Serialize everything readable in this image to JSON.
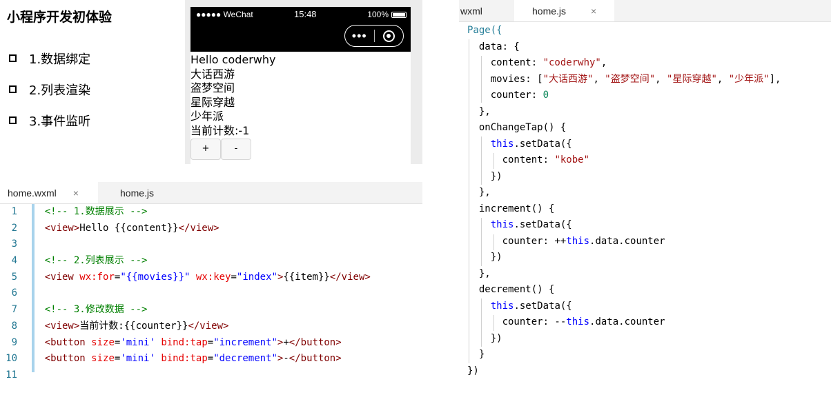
{
  "slide": {
    "title": "小程序开发初体验",
    "bullets": [
      "1.数据绑定",
      "2.列表渲染",
      "3.事件监听"
    ]
  },
  "phone": {
    "carrier": "●●●●● WeChat",
    "time": "15:48",
    "battery": "100%",
    "lines": [
      "Hello coderwhy",
      "大话西游",
      "盗梦空间",
      "星际穿越",
      "少年派",
      "当前计数:-1"
    ],
    "buttons": [
      "+",
      "-"
    ]
  },
  "bottom_editor": {
    "tabs": [
      {
        "label": "home.wxml",
        "close": "×"
      },
      {
        "label": "home.js"
      }
    ],
    "line_numbers": [
      "1",
      "2",
      "3",
      "4",
      "5",
      "6",
      "7",
      "8",
      "9",
      "10",
      "11"
    ]
  },
  "right_editor": {
    "tabs": [
      {
        "label": "wxml"
      },
      {
        "label": "home.js",
        "close": "×"
      }
    ]
  },
  "code": {
    "wxml": {
      "l1": "<!-- 1.数据展示 -->",
      "l2_open": "<view>",
      "l2_text": "Hello {{content}}",
      "l2_close": "</view>",
      "l4": "<!-- 2.列表展示 -->",
      "l5_open": "<view ",
      "l5_attr1": "wx:for",
      "l5_val1": "\"{{movies}}\"",
      "l5_attr2": "wx:key",
      "l5_val2": "\"index\"",
      "l5_text": "{{item}}",
      "l5_close": "</view>",
      "l7": "<!-- 3.修改数据 -->",
      "l8_text": "当前计数:{{counter}}",
      "btn_open": "<button ",
      "size_attr": "size",
      "size_val": "'mini'",
      "bind_attr": "bind:tap",
      "inc_val": "\"increment\"",
      "dec_val": "\"decrement\"",
      "plus": "+",
      "minus": "-",
      "btn_close": "</button>"
    },
    "js": {
      "page": "Page({",
      "data": "data: {",
      "content_key": "content: ",
      "content_val": "\"coderwhy\"",
      "movies_key": "movies: [",
      "movie1": "\"大话西游\"",
      "movie2": "\"盗梦空间\"",
      "movie3": "\"星际穿越\"",
      "movie4": "\"少年派\"",
      "movies_end": "],",
      "counter_key": "counter: ",
      "counter_val": "0",
      "close_obj": "},",
      "on_change": "onChangeTap() {",
      "this_kw": "this",
      "set_data": ".setData({",
      "kobe_val": "\"kobe\"",
      "close_call": "})",
      "increment": "increment() {",
      "inc_expr": "counter: ++",
      "dec_expr": "counter: --",
      "data_counter": ".data.counter",
      "decrement": "decrement() {",
      "close_brace": "}",
      "page_end": "})"
    }
  }
}
